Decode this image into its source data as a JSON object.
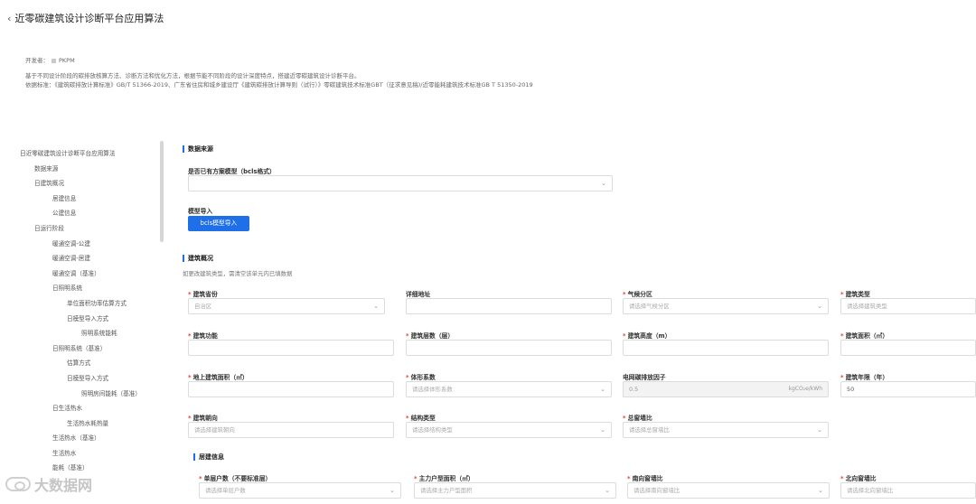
{
  "header": {
    "title": "近零碳建筑设计诊断平台应用算法"
  },
  "intro": {
    "developer_label": "开发者：",
    "developer_name": "PKPM",
    "desc1": "基于不同设计阶段的碳排放核算方法、诊断方法和优化方法，根据节能不同阶段的设计深度特点，搭建近零碳建筑设计诊断平台。",
    "desc2": "依据标准：《建筑碳排放计算标准》GB/T 51366-2019、广东省住房和城乡建设厅《建筑碳排放计算导则（试行）》零碳建筑技术标准GBT（征求意见稿)/近零能耗建筑技术标准GB T 51350-2019"
  },
  "tree": [
    "日近零碳建筑设计诊断平台应用算法",
    "数据来源",
    "日建筑概况",
    "居建信息",
    "公建信息",
    "日运行阶段",
    "暖通空调-公建",
    "暖通空调-居建",
    "暖通空调（基准）",
    "日照明系统",
    "单位面积功率估算方式",
    "日模型导入方式",
    "照明系统能耗",
    "日照明系统（基准）",
    "估算方式",
    "日模型导入方式",
    "照明房间能耗（基准）",
    "日生活热水",
    "生活热水耗热量",
    "生活热水（基准）",
    "生活热水",
    "能耗（基准）"
  ],
  "data_source": {
    "title": "数据来源",
    "has_model_label": "是否已有方案模型（bcls格式）",
    "model_import_label": "模型导入",
    "import_button": "bcls模型导入"
  },
  "overview": {
    "title": "建筑概况",
    "hint": "如更改建筑类型，需清空该单元内已填数据",
    "province": {
      "label": "建筑省份",
      "value": "自治区"
    },
    "address": {
      "label": "详细地址",
      "value": ""
    },
    "climate": {
      "label": "气候分区",
      "value": "请选择气候分区"
    },
    "type": {
      "label": "建筑类型",
      "value": "请选择建筑类型"
    },
    "function": {
      "label": "建筑功能",
      "value": ""
    },
    "floors": {
      "label": "建筑层数（层）",
      "value": ""
    },
    "height": {
      "label": "建筑高度（m）",
      "value": ""
    },
    "area": {
      "label": "建筑面积（㎡）",
      "value": ""
    },
    "ground_area": {
      "label": "地上建筑面积（㎡）",
      "value": ""
    },
    "shape": {
      "label": "体形系数",
      "value": "请选择体形系数"
    },
    "grid_factor": {
      "label": "电网碳排放因子",
      "value": "0.5",
      "unit": "kgCO₂e/kWh"
    },
    "life": {
      "label": "建筑年限（年）",
      "value": "50"
    },
    "orientation": {
      "label": "建筑朝向",
      "value": "请选择建筑朝向"
    },
    "structure": {
      "label": "结构类型",
      "value": "请选择结构类型"
    },
    "wwr": {
      "label": "总窗墙比",
      "value": "请选择总窗墙比"
    }
  },
  "residential": {
    "title": "居建信息",
    "units": {
      "label": "单层户数（不要标准层）",
      "value": "请选择单层户数"
    },
    "main_area": {
      "label": "主力户型面积（㎡）",
      "value": "请选择主力户型面积"
    },
    "south_wwr": {
      "label": "南向窗墙比",
      "value": "请选择南向窗墙比"
    },
    "north_wwr": {
      "label": "北向窗墙比",
      "value": "请选择北向窗墙比"
    }
  },
  "watermark": "大数据网"
}
